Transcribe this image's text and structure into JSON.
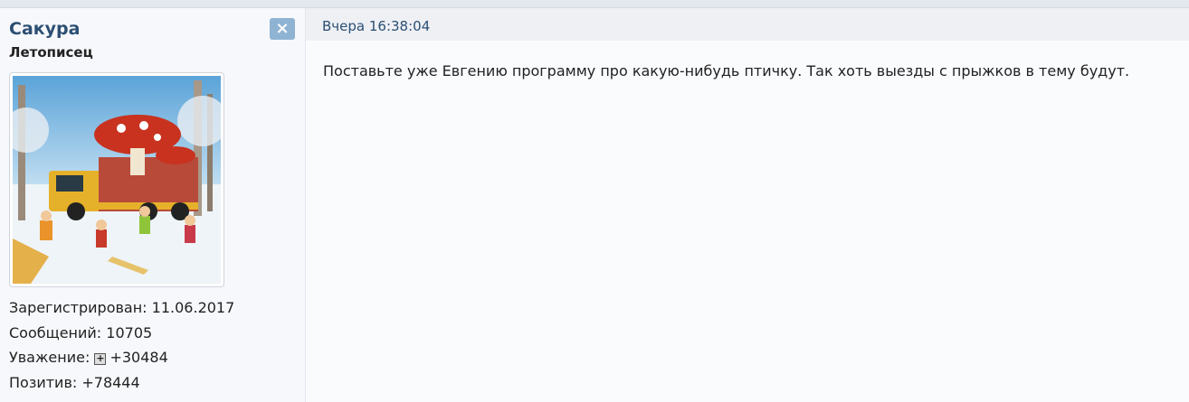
{
  "user": {
    "name": "Сакура",
    "rank": "Летописец",
    "close_symbol": "×",
    "registered_label": "Зарегистрирован:",
    "registered_value": "11.06.2017",
    "messages_label": "Сообщений:",
    "messages_value": "10705",
    "respect_label": "Уважение:",
    "respect_value": "+30484",
    "positive_label": "Позитив:",
    "positive_value": "+78444"
  },
  "post": {
    "date": "Вчера 16:38:04",
    "text": "Поставьте уже Евгению программу про какую-нибудь птичку. Так хоть выезды с прыжков в тему будут."
  },
  "colors": {
    "username": "#2c4f73",
    "close_button": "#8fb3d3",
    "header_bg": "#eef0f4"
  }
}
